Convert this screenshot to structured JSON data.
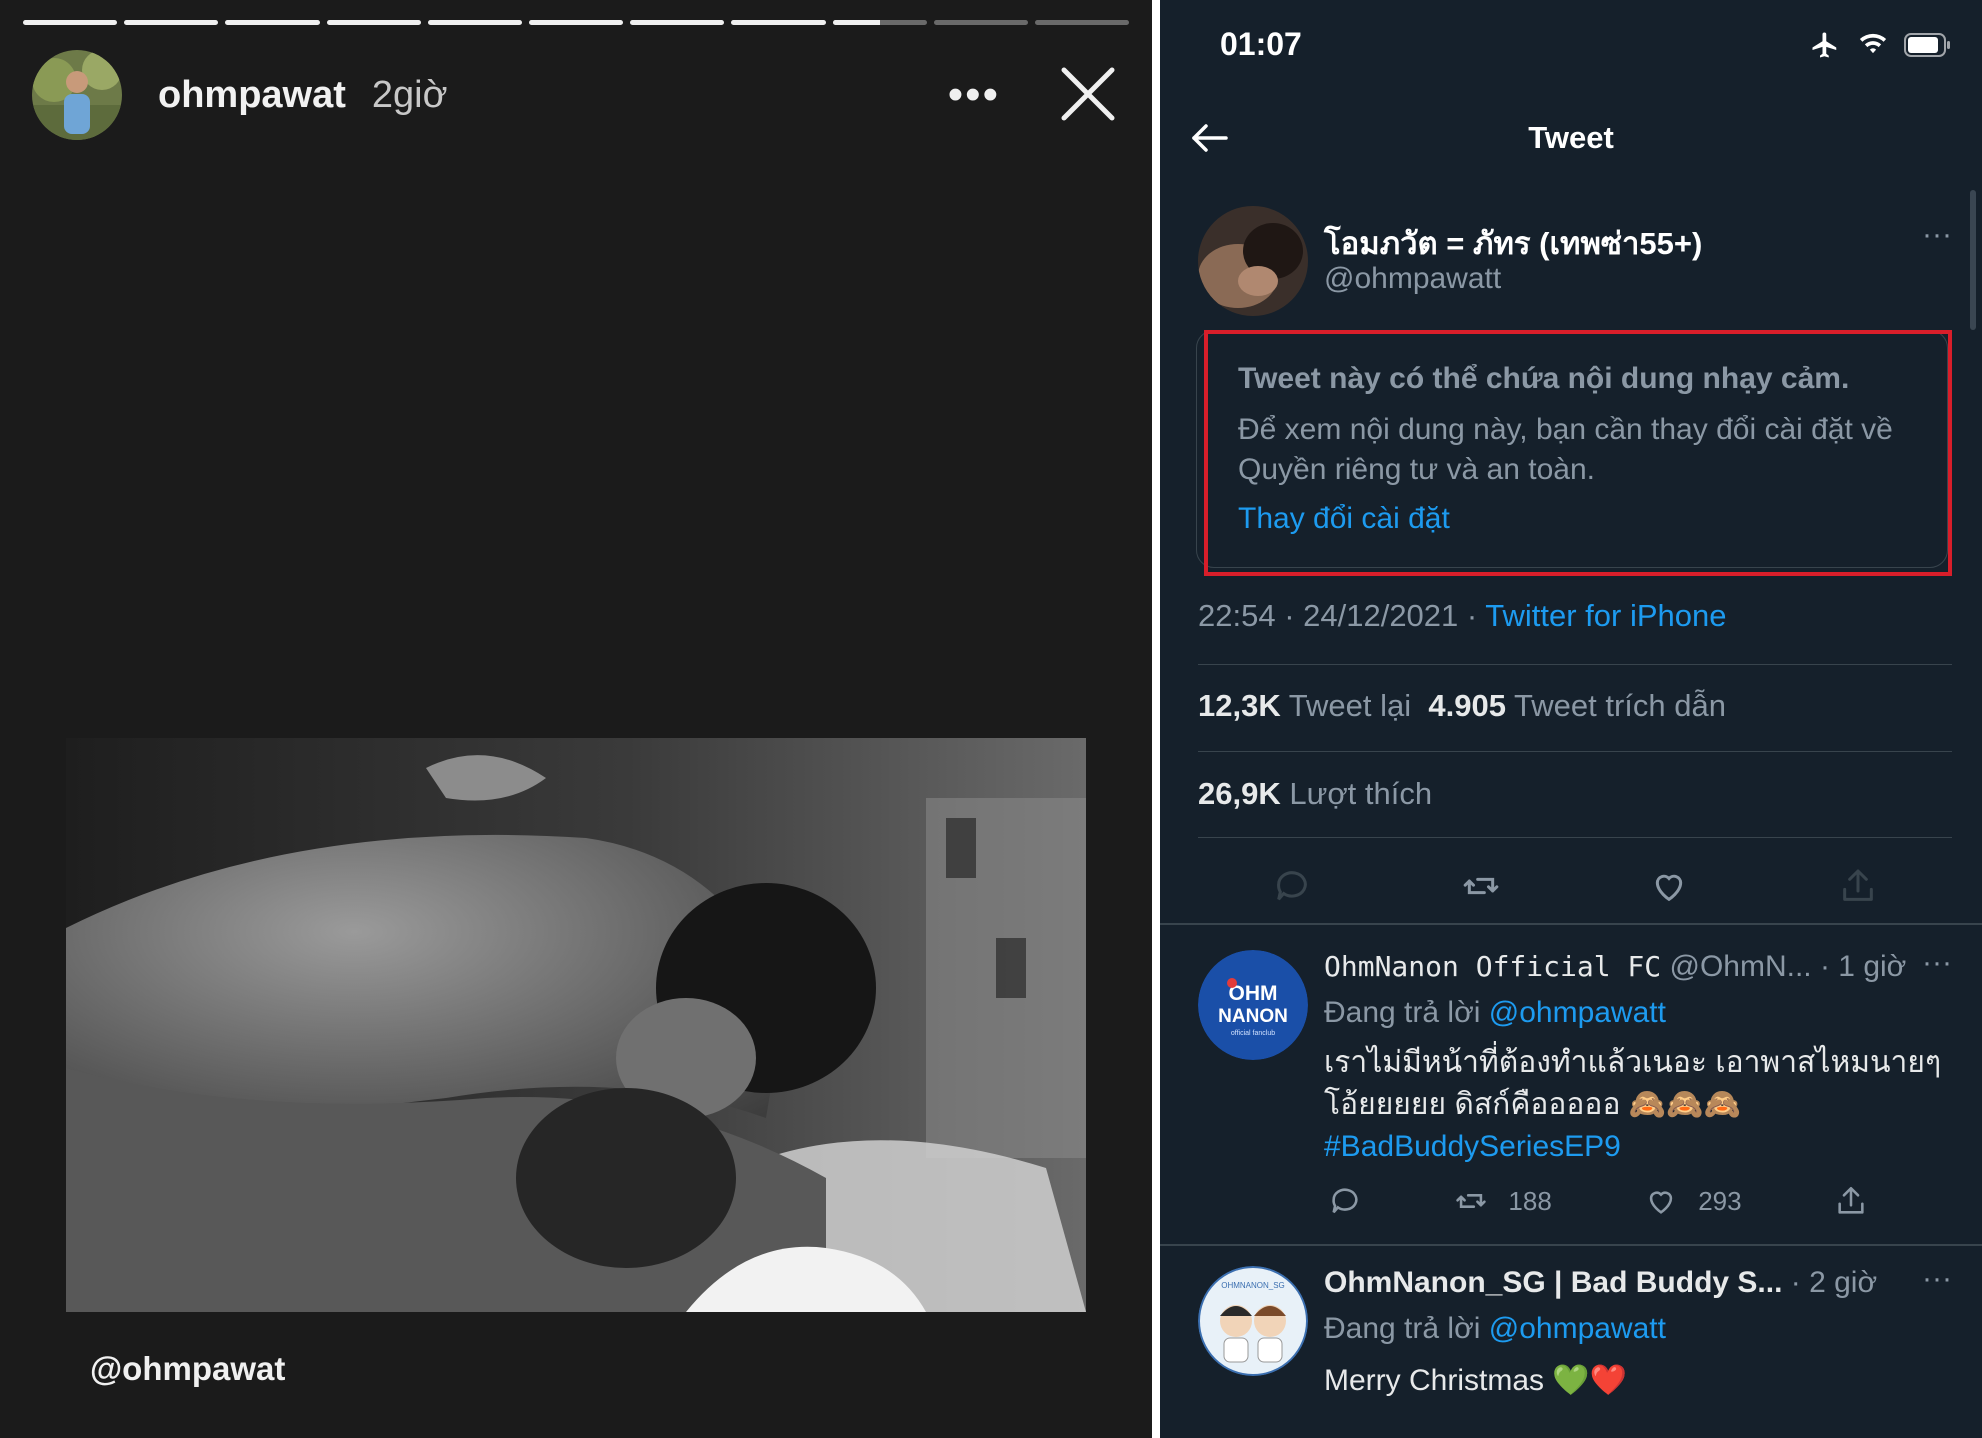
{
  "story": {
    "username": "ohmpawat",
    "time_ago": "2giờ",
    "more_label": "•••",
    "tag": "@ohmpawat",
    "progress": {
      "segments": 11,
      "completed": 8,
      "current_fraction": 0.5
    }
  },
  "twitter": {
    "status_bar": {
      "time": "01:07"
    },
    "nav": {
      "title": "Tweet"
    },
    "tweet": {
      "display_name": "โอมภวัต = ภัทร (เทพซ่า55+)",
      "handle": "@ohmpawatt",
      "more": "···",
      "warning_title": "Tweet này có thể chứa nội dung nhạy cảm.",
      "warning_body": "Để xem nội dung này, bạn cần thay đổi cài đặt về Quyền riêng tư và an toàn.",
      "warning_link": "Thay đổi cài đặt",
      "timestamp": "22:54 · 24/12/2021 · ",
      "source": "Twitter for iPhone",
      "retweets_count": "12,3K",
      "retweets_label": "Tweet lại",
      "quotes_count": "4.905",
      "quotes_label": "Tweet trích dẫn",
      "likes_count": "26,9K",
      "likes_label": "Lượt thích"
    },
    "replies": [
      {
        "name": "OhmNanon Official FC",
        "handle": "@OhmN...",
        "time": "· 1 giờ",
        "more": "···",
        "replying_prefix": "Đang trả lời ",
        "replying_to": "@ohmpawatt",
        "text_line1": "เราไม่มีหน้าที่ต้องทำแล้วเนอะ เอาพาสไหมนายๆ",
        "text_line2": "โอ้ยยยยย ดิสก์คือออออ 🙈🙈🙈",
        "hashtag": "#BadBuddySeriesEP9",
        "retweets": "188",
        "likes": "293",
        "avatar_text_1": "OHM",
        "avatar_text_2": "NANON",
        "avatar_text_3": "official fanclub"
      },
      {
        "name": "OhmNanon_SG | Bad Buddy S...",
        "time": "· 2 giờ",
        "more": "···",
        "replying_prefix": "Đang trả lời ",
        "replying_to": "@ohmpawatt",
        "text_line1": "Merry Christmas 💚❤️",
        "avatar_text": "OHMNANON_SG"
      }
    ]
  },
  "colors": {
    "twitter_bg": "#15202b",
    "accent_blue": "#1d9bf0",
    "highlight_red": "#d81e2a",
    "story_bg": "#1b1b1b"
  }
}
